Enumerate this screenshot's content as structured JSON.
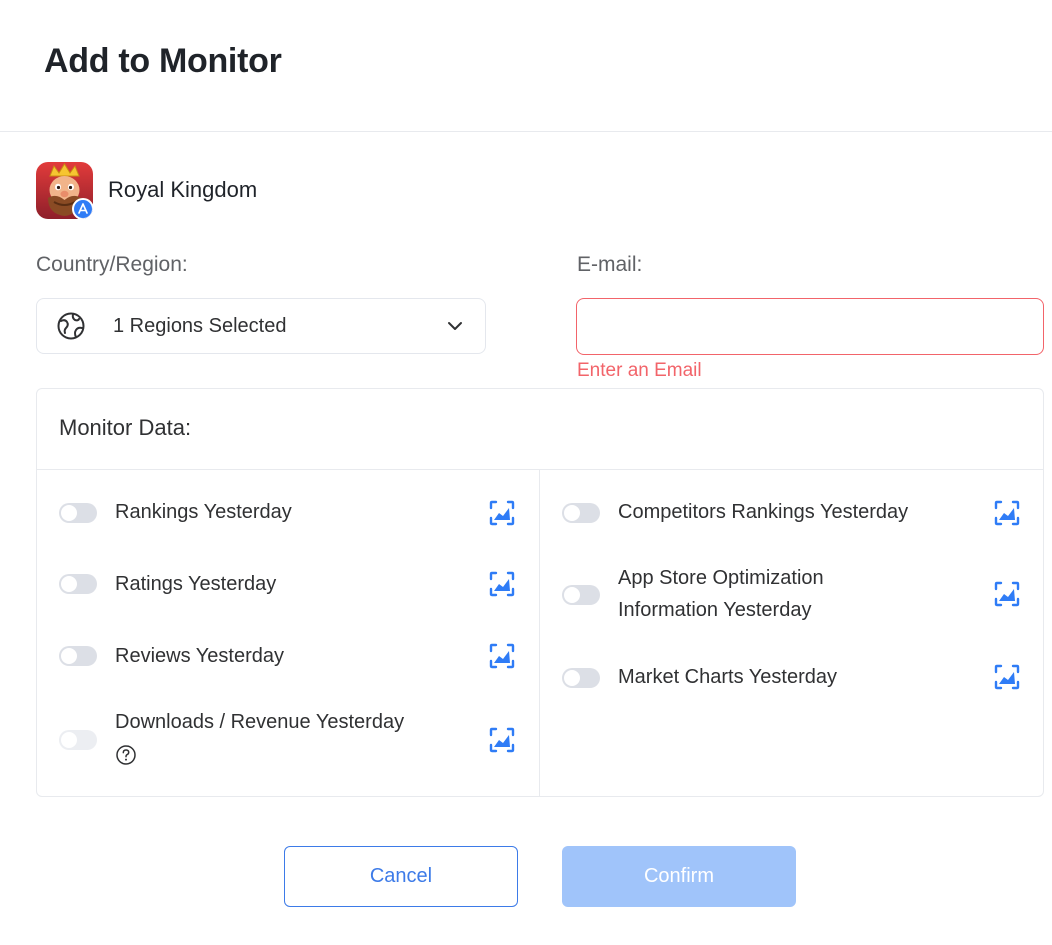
{
  "dialog": {
    "title": "Add to Monitor"
  },
  "app": {
    "name": "Royal Kingdom",
    "icon": "royal-kingdom-app-icon",
    "store_badge": "app-store-icon"
  },
  "region": {
    "label": "Country/Region:",
    "value": "1 Regions Selected",
    "icon": "globe-icon"
  },
  "email": {
    "label": "E-mail:",
    "value": "",
    "placeholder": "",
    "error": "Enter an Email"
  },
  "monitor": {
    "title": "Monitor Data:",
    "left_options": [
      {
        "label": "Rankings Yesterday",
        "enabled": false
      },
      {
        "label": "Ratings Yesterday",
        "enabled": false
      },
      {
        "label": "Reviews Yesterday",
        "enabled": false
      },
      {
        "label": "Downloads / Revenue Yesterday",
        "enabled": false,
        "disabled": true,
        "help": true
      }
    ],
    "right_options": [
      {
        "label": "Competitors Rankings Yesterday",
        "enabled": false
      },
      {
        "label": "App Store Optimization Information Yesterday",
        "enabled": false
      },
      {
        "label": "Market Charts Yesterday",
        "enabled": false
      }
    ]
  },
  "actions": {
    "cancel": "Cancel",
    "confirm": "Confirm"
  },
  "colors": {
    "primary": "#3d7be8",
    "error": "#f2646a",
    "confirm_disabled": "#a0c4fa"
  }
}
